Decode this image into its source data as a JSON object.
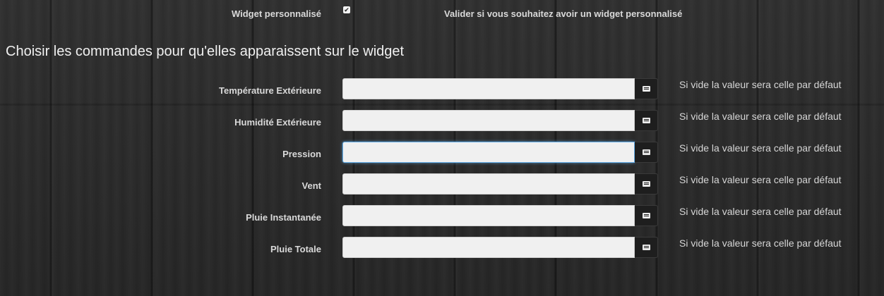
{
  "widget": {
    "label": "Widget personnalisé",
    "checked": true,
    "check_glyph": "✔",
    "help": "Valider si vous souhaitez avoir un widget personnalisé"
  },
  "section": {
    "title": "Choisir les commandes pour qu'elles apparaissent sur le widget"
  },
  "rows": [
    {
      "label": "Température Extérieure",
      "value": "",
      "icon": "list-alt-icon",
      "help": "Si vide la valeur sera celle par défaut"
    },
    {
      "label": "Humidité Extérieure",
      "value": "",
      "icon": "list-alt-icon",
      "help": "Si vide la valeur sera celle par défaut"
    },
    {
      "label": "Pression",
      "value": "",
      "icon": "list-alt-icon",
      "help": "Si vide la valeur sera celle par défaut",
      "focused": true
    },
    {
      "label": "Vent",
      "value": "",
      "icon": "list-alt-icon",
      "help": "Si vide la valeur sera celle par défaut"
    },
    {
      "label": "Pluie Instantanée",
      "value": "",
      "icon": "list-alt-icon",
      "help": "Si vide la valeur sera celle par défaut"
    },
    {
      "label": "Pluie Totale",
      "value": "",
      "icon": "list-alt-icon",
      "help": "Si vide la valeur sera celle par défaut"
    }
  ],
  "colors": {
    "background": "#2b2b2b",
    "input_bg": "#f0f0f0",
    "focus_border": "#66afe9",
    "button_bg": "#1e1e1e",
    "text": "#d9d9d9"
  }
}
